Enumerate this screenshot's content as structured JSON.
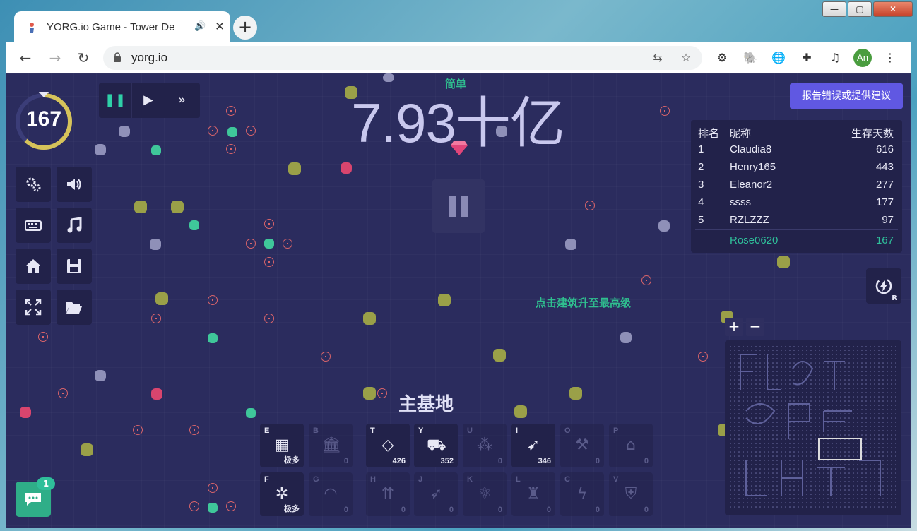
{
  "browser": {
    "tab_title": "YORG.io Game - Tower De",
    "url": "yorg.io",
    "profile_initials": "An",
    "new_tab": "+",
    "window_buttons": [
      "—",
      "▢",
      "✕"
    ]
  },
  "game": {
    "population": "7.93十亿",
    "difficulty": "简单",
    "level": "167",
    "level_progress": 0.62,
    "report_button": "报告错误或提供建议",
    "hint": "点击建筑升至最高级",
    "building_label": "主基地",
    "chat_badge": "1",
    "sound_r_key": "R",
    "zoom_in": "+",
    "zoom_out": "−",
    "leaderboard": {
      "headers": [
        "排名",
        "昵称",
        "生存天数"
      ],
      "rows": [
        {
          "rank": "1",
          "name": "Claudia8",
          "days": "616"
        },
        {
          "rank": "2",
          "name": "Henry165",
          "days": "443"
        },
        {
          "rank": "3",
          "name": "Eleanor2",
          "days": "277"
        },
        {
          "rank": "4",
          "name": "ssss",
          "days": "177"
        },
        {
          "rank": "5",
          "name": "RZLZZZ",
          "days": "97"
        }
      ],
      "self": {
        "name": "Rose0620",
        "days": "167"
      }
    },
    "buildings_row1": [
      {
        "key": "E",
        "count": "极多",
        "icon": "wall-icon",
        "active": true
      },
      {
        "key": "B",
        "count": "0",
        "icon": "bank-icon",
        "active": false
      },
      {
        "key": "T",
        "count": "426",
        "icon": "gem-icon",
        "active": true
      },
      {
        "key": "Y",
        "count": "352",
        "icon": "minecart-icon",
        "active": true
      },
      {
        "key": "U",
        "count": "0",
        "icon": "ore-icon",
        "active": false
      },
      {
        "key": "I",
        "count": "346",
        "icon": "cannon-icon",
        "active": true
      },
      {
        "key": "O",
        "count": "0",
        "icon": "axe-icon",
        "active": false
      },
      {
        "key": "P",
        "count": "0",
        "icon": "factory-icon",
        "active": false
      }
    ],
    "buildings_row2": [
      {
        "key": "F",
        "count": "极多",
        "icon": "network-icon",
        "active": true
      },
      {
        "key": "G",
        "count": "0",
        "icon": "dome-icon",
        "active": false
      },
      {
        "key": "H",
        "count": "0",
        "icon": "arrows-icon",
        "active": false
      },
      {
        "key": "J",
        "count": "0",
        "icon": "rocket-icon",
        "active": false
      },
      {
        "key": "K",
        "count": "0",
        "icon": "atom-icon",
        "active": false
      },
      {
        "key": "L",
        "count": "0",
        "icon": "reactor-icon",
        "active": false
      },
      {
        "key": "C",
        "count": "0",
        "icon": "lightning-icon",
        "active": false
      },
      {
        "key": "V",
        "count": "0",
        "icon": "shield-icon",
        "active": false
      }
    ]
  }
}
